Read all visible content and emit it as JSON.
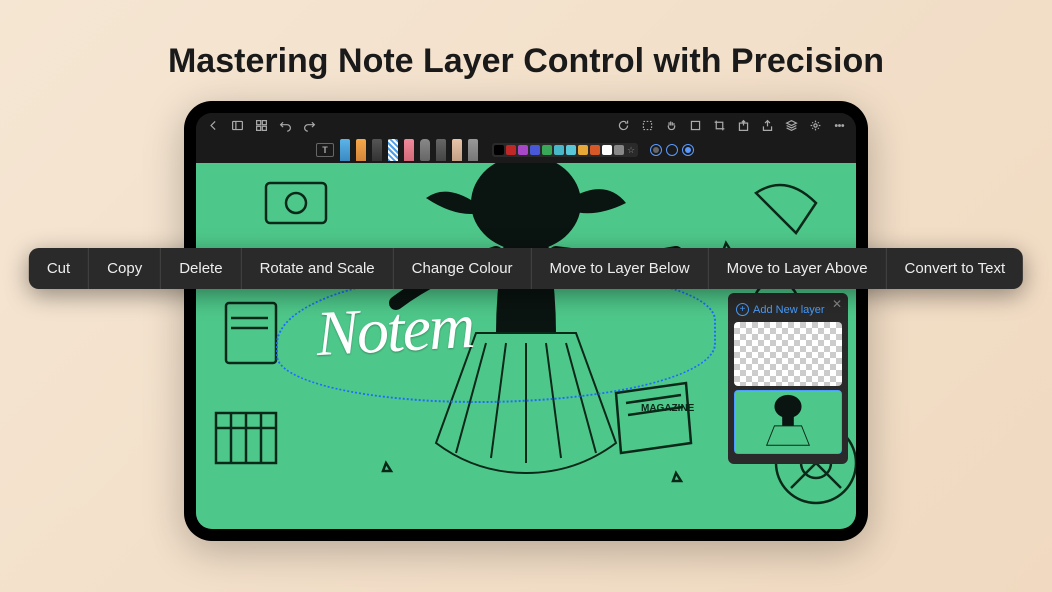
{
  "banner": {
    "title": "Mastering Note Layer Control with Precision"
  },
  "top_toolbar": {
    "left_icons": [
      "back-icon",
      "panel-icon",
      "grid-icon",
      "undo-icon",
      "redo-icon"
    ],
    "right_icons": [
      "refresh-icon",
      "select-icon",
      "hand-icon",
      "fit-icon",
      "crop-icon",
      "export-icon",
      "share-icon",
      "layers-icon",
      "settings-icon",
      "more-icon"
    ]
  },
  "tools": {
    "text_label": "T",
    "pens": [
      "pen-blue",
      "pen-orange",
      "pen-dark",
      "pen-highlighter",
      "pen-pink-eraser",
      "pen-smudge",
      "pen-pencil",
      "pen-brush",
      "pen-gray"
    ]
  },
  "palette": [
    "#000000",
    "#c02828",
    "#a848c8",
    "#4858d8",
    "#38a858",
    "#48b8c8",
    "#58c8d8",
    "#e8a838",
    "#d85828",
    "#ffffff",
    "#888888"
  ],
  "canvas": {
    "signature_text": "Notem",
    "magazine_label": "MAGAZINE",
    "selection_active": true
  },
  "context_menu": {
    "items": [
      "Cut",
      "Copy",
      "Delete",
      "Rotate and Scale",
      "Change Colour",
      "Move to Layer Below",
      "Move to Layer Above",
      "Convert to Text"
    ]
  },
  "layer_panel": {
    "add_label": "Add New layer",
    "layers": [
      {
        "id": "layer-empty",
        "type": "transparent"
      },
      {
        "id": "layer-artwork",
        "type": "artwork",
        "selected": true
      }
    ]
  }
}
